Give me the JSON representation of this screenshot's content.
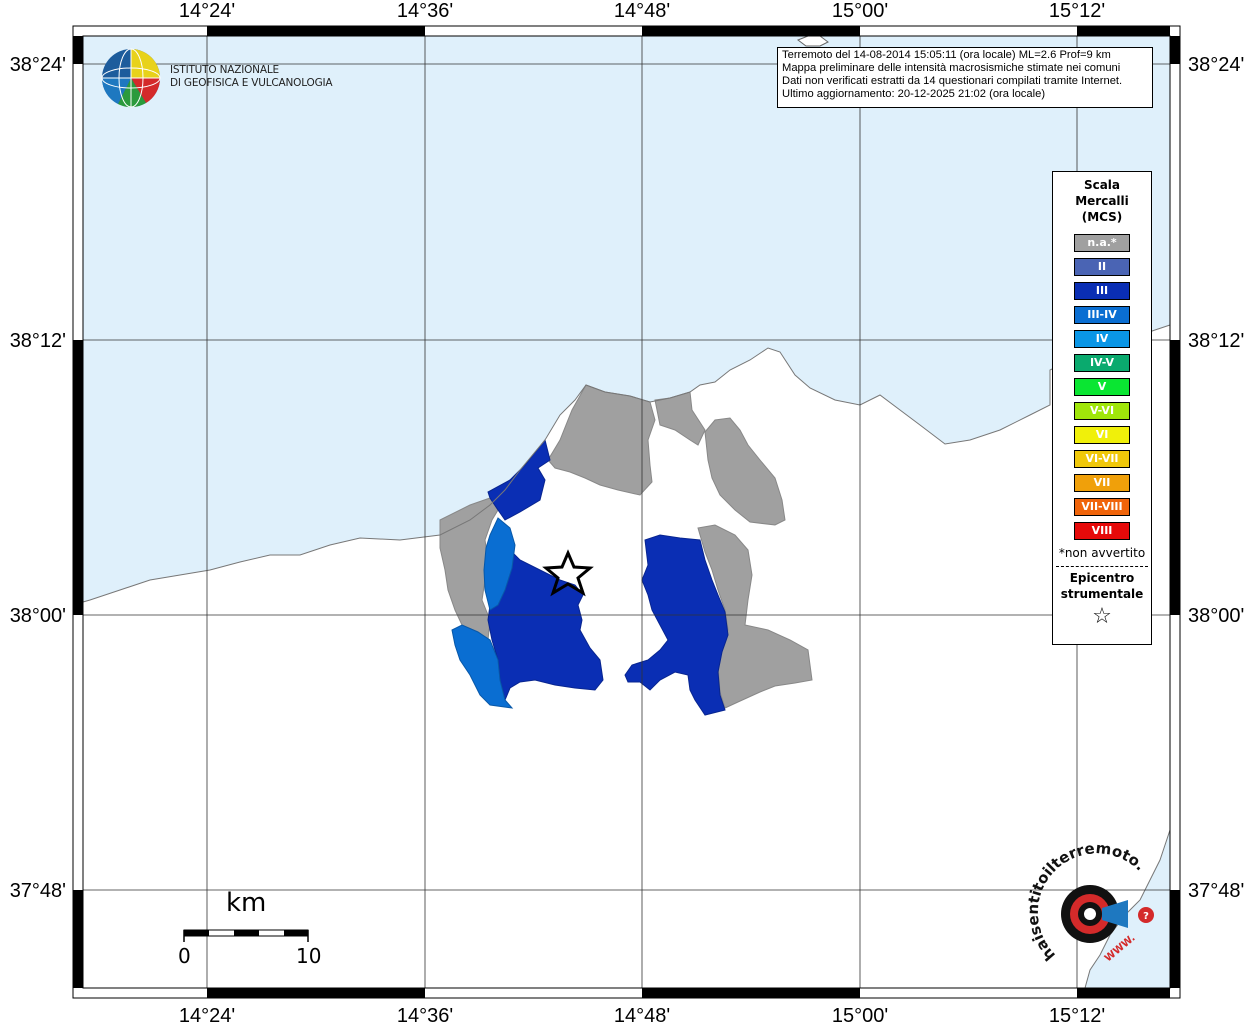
{
  "map": {
    "lon_labels": [
      "14°24'",
      "14°36'",
      "14°48'",
      "15°00'",
      "15°12'"
    ],
    "lat_labels": [
      "38°24'",
      "38°12'",
      "38°00'",
      "37°48'"
    ]
  },
  "header": {
    "lines": [
      "Terremoto del 14-08-2014 15:05:11 (ora locale) ML=2.6 Prof=9 km",
      "Mappa preliminare delle intensità macrosismiche stimate nei comuni",
      "Dati non verificati estratti da 14 questionari compilati tramite Internet.",
      "Ultimo aggiornamento: 20-12-2025 21:02 (ora locale)"
    ]
  },
  "logo": {
    "line1": "ISTITUTO NAZIONALE",
    "line2": "DI GEOFISICA E VULCANOLOGIA"
  },
  "legend": {
    "title": [
      "Scala",
      "Mercalli",
      "(MCS)"
    ],
    "items": [
      {
        "label": "n.a.*",
        "color": "#a0a0a0"
      },
      {
        "label": "II",
        "color": "#4a64b4"
      },
      {
        "label": "III",
        "color": "#0a2eb4"
      },
      {
        "label": "III-IV",
        "color": "#0a6ed2"
      },
      {
        "label": "IV",
        "color": "#0a96e6"
      },
      {
        "label": "IV-V",
        "color": "#0aaa6e"
      },
      {
        "label": "V",
        "color": "#0ae632"
      },
      {
        "label": "V-VI",
        "color": "#a0e60a"
      },
      {
        "label": "VI",
        "color": "#f0f00a"
      },
      {
        "label": "VI-VII",
        "color": "#f0c80a"
      },
      {
        "label": "VII",
        "color": "#f0a00a"
      },
      {
        "label": "VII-VIII",
        "color": "#f0640a"
      },
      {
        "label": "VIII",
        "color": "#e60a0a"
      }
    ],
    "note": "*non avvertito",
    "epicenter_label": [
      "Epicentro",
      "strumentale"
    ],
    "epicenter_symbol": "☆"
  },
  "scalebar": {
    "unit": "km",
    "start": "0",
    "end": "10"
  },
  "colors": {
    "sea": "#dff0fb",
    "land": "#ffffff",
    "na": "#a0a0a0",
    "iii": "#0a2eb4",
    "iii_iv": "#0a6ed2"
  },
  "watermark": {
    "text": "haisentitoilterremoto.it",
    "url": "WWW."
  }
}
